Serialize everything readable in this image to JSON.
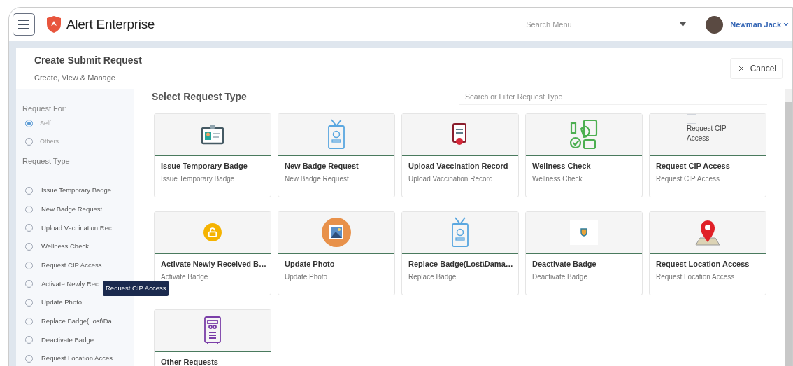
{
  "header": {
    "brand": "Alert Enterprise",
    "search": {
      "placeholder": "Search Menu"
    },
    "user": {
      "name": "Newman Jack"
    }
  },
  "page": {
    "title": "Create Submit Request",
    "subtitle": "Create, View & Manage",
    "cancel_button": "Cancel"
  },
  "sidebar": {
    "request_for_label": "Request For:",
    "request_for": [
      {
        "label": "Self",
        "selected": true
      },
      {
        "label": "Others",
        "selected": false
      }
    ],
    "request_type_label": "Request Type",
    "request_types": [
      {
        "label": "Issue Temporary Badge",
        "selected": false
      },
      {
        "label": "New Badge Request",
        "selected": false
      },
      {
        "label": "Upload Vaccination Rec",
        "selected": false
      },
      {
        "label": "Wellness Check",
        "selected": false
      },
      {
        "label": "Request CIP Access",
        "selected": false
      },
      {
        "label": "Activate Newly Rec",
        "selected": false
      },
      {
        "label": "Update Photo",
        "selected": false
      },
      {
        "label": "Replace Badge(Lost\\Da",
        "selected": false
      },
      {
        "label": "Deactivate Badge",
        "selected": false
      },
      {
        "label": "Request Location Acces",
        "selected": false
      }
    ],
    "tooltip": "Request CIP Access"
  },
  "main": {
    "title": "Select Request Type",
    "filter": {
      "placeholder": "Search or Filter Request Type"
    },
    "cards": [
      {
        "kind": "id-card",
        "title": "Issue Temporary Badge",
        "subtitle": "Issue Temporary Badge"
      },
      {
        "kind": "lanyard",
        "title": "New Badge Request",
        "subtitle": "New Badge Request"
      },
      {
        "kind": "document",
        "title": "Upload Vaccination Record",
        "subtitle": "Upload Vaccination Record"
      },
      {
        "kind": "wellness",
        "title": "Wellness Check",
        "subtitle": "Wellness Check"
      },
      {
        "kind": "broken",
        "alt_text": "Request CIP Access",
        "title": "Request CIP Access",
        "subtitle": "Request CIP Access"
      },
      {
        "kind": "lock",
        "title": "Activate Newly Received B…",
        "subtitle": "Activate Badge"
      },
      {
        "kind": "photo",
        "title": "Update Photo",
        "subtitle": "Update Photo"
      },
      {
        "kind": "lanyard",
        "title": "Replace Badge(Lost\\Dama…",
        "subtitle": "Replace Badge"
      },
      {
        "kind": "shield",
        "title": "Deactivate Badge",
        "subtitle": "Deactivate Badge"
      },
      {
        "kind": "pin",
        "title": "Request Location Access",
        "subtitle": "Request Location Access"
      },
      {
        "kind": "device",
        "title": "Other Requests"
      }
    ]
  }
}
